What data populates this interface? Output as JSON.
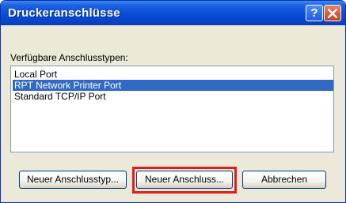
{
  "dialog": {
    "title": "Druckeranschlüsse",
    "help_label": "?",
    "available_label": "Verfügbare Anschlusstypen:",
    "ports": [
      {
        "label": "Local Port",
        "selected": false
      },
      {
        "label": "RPT Network Printer Port",
        "selected": true
      },
      {
        "label": "Standard TCP/IP Port",
        "selected": false
      }
    ],
    "buttons": {
      "new_type": "Neuer Anschlusstyp...",
      "new_port": "Neuer Anschluss...",
      "cancel": "Abbrechen"
    },
    "colors": {
      "title_bar": "#0a4fd8",
      "selection": "#316ac5",
      "highlight_outline": "#e01c1c",
      "dialog_bg": "#ece9d8"
    }
  }
}
